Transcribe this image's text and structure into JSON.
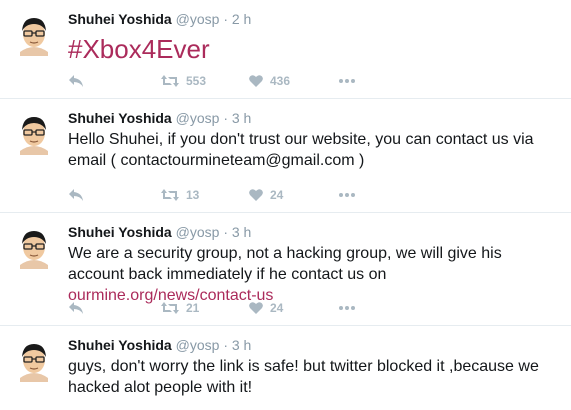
{
  "colors": {
    "accent": "#ab2b5b",
    "muted": "#8899a6",
    "icon": "#aab8c2"
  },
  "tweets": [
    {
      "name": "Shuhei Yoshida",
      "handle": "@yosp",
      "dot": "·",
      "time": "2 h",
      "text": "#Xbox4Ever",
      "retweets": "553",
      "likes": "436"
    },
    {
      "name": "Shuhei Yoshida",
      "handle": "@yosp",
      "dot": "·",
      "time": "3 h",
      "text": "Hello Shuhei, if you don't trust our website, you can contact us via email ( contactourmineteam@gmail.com )",
      "retweets": "13",
      "likes": "24"
    },
    {
      "name": "Shuhei Yoshida",
      "handle": "@yosp",
      "dot": "·",
      "time": "3 h",
      "text_before": "We are a security group, not a hacking group, we will give his account back immediately if he contact us on ",
      "link": "ourmine.org/news/contact-us",
      "retweets": "21",
      "likes": "24"
    },
    {
      "name": "Shuhei Yoshida",
      "handle": "@yosp",
      "dot": "·",
      "time": "3 h",
      "text": "guys, don't worry the link is safe! but twitter blocked it ,because we hacked alot people with it!"
    }
  ],
  "icons": {
    "avatar": "avatar-icon",
    "reply": "reply-icon",
    "retweet": "retweet-icon",
    "like": "heart-icon",
    "more": "more-icon"
  }
}
